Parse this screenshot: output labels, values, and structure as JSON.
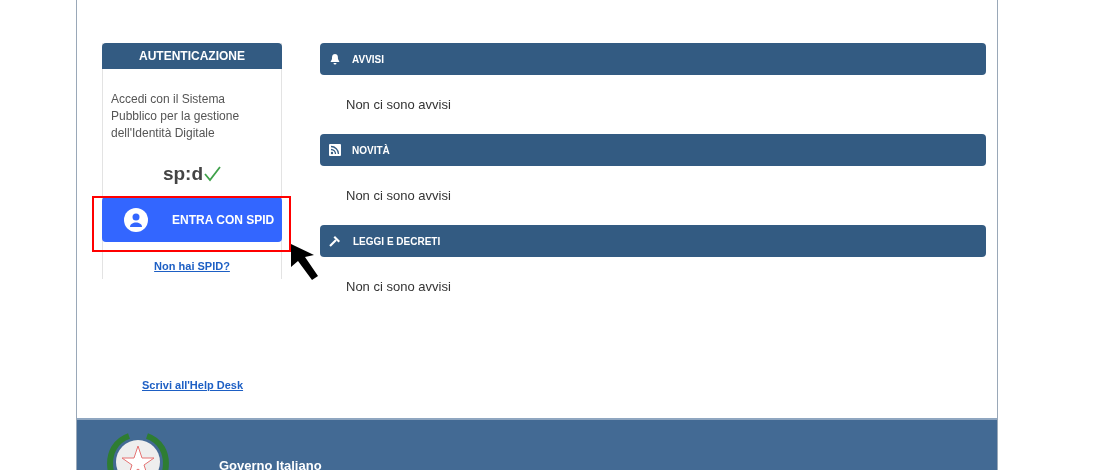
{
  "auth": {
    "title": "AUTENTICAZIONE",
    "text": "Accedi con il Sistema Pubblico per la gestione dell'Identità Digitale",
    "logo": "sp:d",
    "button": "ENTRA CON SPID",
    "link": "Non hai SPID?"
  },
  "sections": [
    {
      "kind": "bell",
      "title": "AVVISI",
      "body": "Non ci sono avvisi"
    },
    {
      "kind": "rss",
      "title": "NOVITÀ",
      "body": "Non ci sono avvisi"
    },
    {
      "kind": "gavel",
      "title": "LEGGI E DECRETI",
      "body": "Non ci sono avvisi"
    }
  ],
  "helpdesk_link": "Scrivi all'Help Desk",
  "footer": {
    "title": "Governo Italiano"
  }
}
